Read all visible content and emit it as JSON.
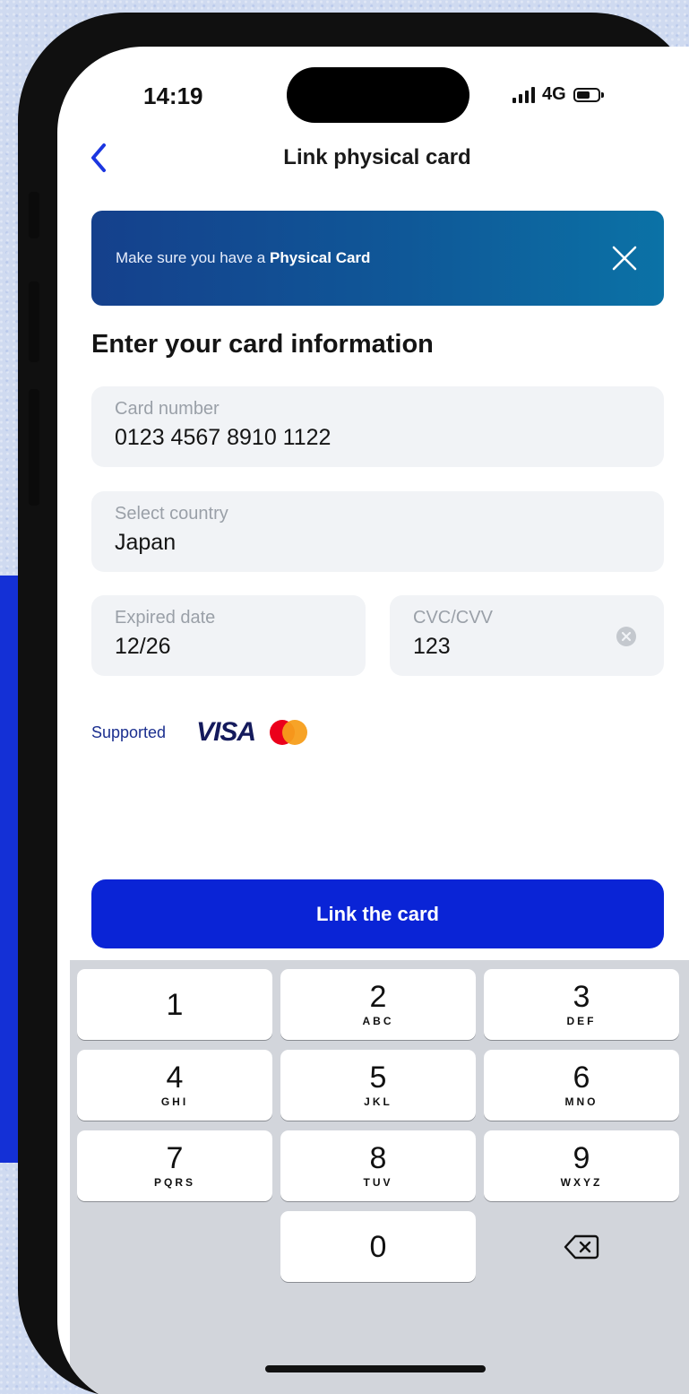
{
  "status_bar": {
    "time": "14:19",
    "network": "4G"
  },
  "header": {
    "title": "Link physical card",
    "back_icon": "chevron-left-icon"
  },
  "banner": {
    "text_prefix": "Make sure you have a ",
    "text_bold": "Physical Card",
    "close_icon": "close-icon"
  },
  "form": {
    "section_title": "Enter your card information",
    "card_number": {
      "label": "Card number",
      "value": "0123 4567 8910 1122"
    },
    "country": {
      "label": "Select country",
      "value": "Japan"
    },
    "expiry": {
      "label": "Expired date",
      "value": "12/26"
    },
    "cvc": {
      "label": "CVC/CVV",
      "value": "123"
    }
  },
  "supported": {
    "label": "Supported",
    "brands": [
      "VISA",
      "mastercard-logo"
    ]
  },
  "cta": {
    "label": "Link the card"
  },
  "keypad": {
    "keys": [
      {
        "num": "1",
        "letters": ""
      },
      {
        "num": "2",
        "letters": "ABC"
      },
      {
        "num": "3",
        "letters": "DEF"
      },
      {
        "num": "4",
        "letters": "GHI"
      },
      {
        "num": "5",
        "letters": "JKL"
      },
      {
        "num": "6",
        "letters": "MNO"
      },
      {
        "num": "7",
        "letters": "PQRS"
      },
      {
        "num": "8",
        "letters": "TUV"
      },
      {
        "num": "9",
        "letters": "WXYZ"
      },
      {
        "num": "0",
        "letters": ""
      }
    ],
    "delete_icon": "backspace-icon"
  },
  "colors": {
    "primary": "#0a24d6",
    "banner_start": "#15408c",
    "banner_end": "#0b72a6",
    "field_bg": "#f1f3f6",
    "keypad_bg": "#d2d5db"
  }
}
